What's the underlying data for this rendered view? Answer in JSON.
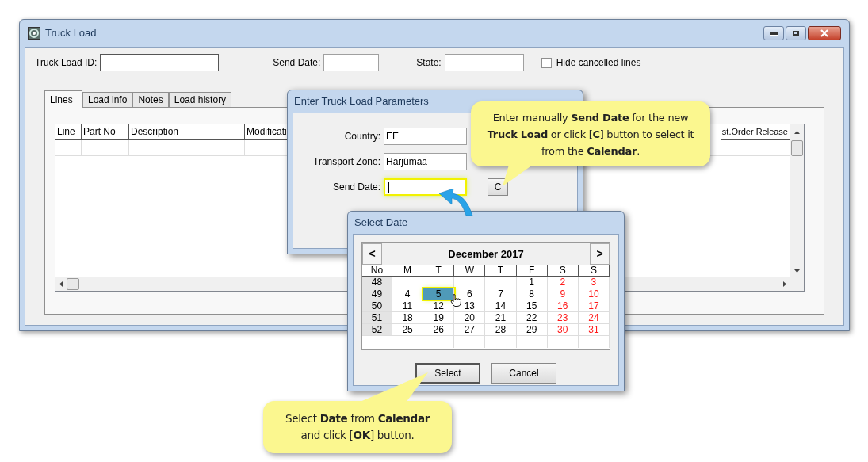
{
  "window": {
    "title": "Truck Load"
  },
  "header_fields": [
    {
      "label": "Truck Load ID:",
      "focused": true
    },
    {
      "label": "Send Date:",
      "focused": false
    },
    {
      "label": "State:",
      "focused": false
    }
  ],
  "hide_cancelled": {
    "label": "Hide cancelled lines",
    "checked": false
  },
  "tabs": [
    {
      "label": "Lines",
      "selected": true
    },
    {
      "label": "Load info",
      "selected": false
    },
    {
      "label": "Notes",
      "selected": false
    },
    {
      "label": "Load history",
      "selected": false
    }
  ],
  "table": {
    "columns_left": [
      "Line",
      "Part No",
      "Description",
      "Modificati"
    ],
    "columns_right": [
      "st.Order Release"
    ]
  },
  "params_dialog": {
    "title": "Enter Truck Load Parameters",
    "fields": [
      {
        "label": "Country:",
        "value": "EE",
        "highlighted": false,
        "focused": false
      },
      {
        "label": "Transport Zone:",
        "value": "Harjümaa",
        "highlighted": false,
        "focused": false
      },
      {
        "label": "Send Date:",
        "highlighted": true,
        "focused": true
      }
    ],
    "calendar_button": "C"
  },
  "date_dialog": {
    "title": "Select Date",
    "prev": "<",
    "next": ">",
    "month": "December 2017",
    "headers": [
      "No",
      "M",
      "T",
      "W",
      "T",
      "F",
      "S",
      "S"
    ],
    "weeks": [
      {
        "no": "48",
        "days": [
          {
            "text": "1",
            "weekend": false,
            "selected": false
          },
          {
            "text": "2",
            "weekend": true,
            "selected": false
          },
          {
            "text": "3",
            "weekend": true,
            "selected": false
          }
        ]
      },
      {
        "no": "49",
        "days": [
          {
            "text": "4",
            "weekend": false,
            "selected": false
          },
          {
            "text": "5",
            "weekend": false,
            "selected": true
          },
          {
            "text": "6",
            "weekend": false,
            "selected": false
          },
          {
            "text": "7",
            "weekend": false,
            "selected": false
          },
          {
            "text": "8",
            "weekend": false,
            "selected": false
          },
          {
            "text": "9",
            "weekend": true,
            "selected": false
          },
          {
            "text": "10",
            "weekend": true,
            "selected": false
          }
        ]
      },
      {
        "no": "50",
        "days": [
          {
            "text": "11",
            "weekend": false,
            "selected": false
          },
          {
            "text": "12",
            "weekend": false,
            "selected": false
          },
          {
            "text": "13",
            "weekend": false,
            "selected": false
          },
          {
            "text": "14",
            "weekend": false,
            "selected": false
          },
          {
            "text": "15",
            "weekend": false,
            "selected": false
          },
          {
            "text": "16",
            "weekend": true,
            "selected": false
          },
          {
            "text": "17",
            "weekend": true,
            "selected": false
          }
        ]
      },
      {
        "no": "51",
        "days": [
          {
            "text": "18",
            "weekend": false,
            "selected": false
          },
          {
            "text": "19",
            "weekend": false,
            "selected": false
          },
          {
            "text": "20",
            "weekend": false,
            "selected": false
          },
          {
            "text": "21",
            "weekend": false,
            "selected": false
          },
          {
            "text": "22",
            "weekend": false,
            "selected": false
          },
          {
            "text": "23",
            "weekend": true,
            "selected": false
          },
          {
            "text": "24",
            "weekend": true,
            "selected": false
          }
        ]
      },
      {
        "no": "52",
        "days": [
          {
            "text": "25",
            "weekend": false,
            "selected": false
          },
          {
            "text": "26",
            "weekend": false,
            "selected": false
          },
          {
            "text": "27",
            "weekend": false,
            "selected": false
          },
          {
            "text": "28",
            "weekend": false,
            "selected": false
          },
          {
            "text": "29",
            "weekend": false,
            "selected": false
          },
          {
            "text": "30",
            "weekend": true,
            "selected": false
          },
          {
            "text": "31",
            "weekend": true,
            "selected": false
          }
        ]
      }
    ],
    "buttons": [
      {
        "label": "Select",
        "default": true
      },
      {
        "label": "Cancel",
        "default": false
      }
    ]
  },
  "callouts": [
    {
      "text": "Enter manually **Send Date** for the new **Truck Load** or click [**C**] button to select it from the **Calendar**."
    },
    {
      "text": "Select **Date** from **Calendar** and click [**OK**] button."
    }
  ]
}
